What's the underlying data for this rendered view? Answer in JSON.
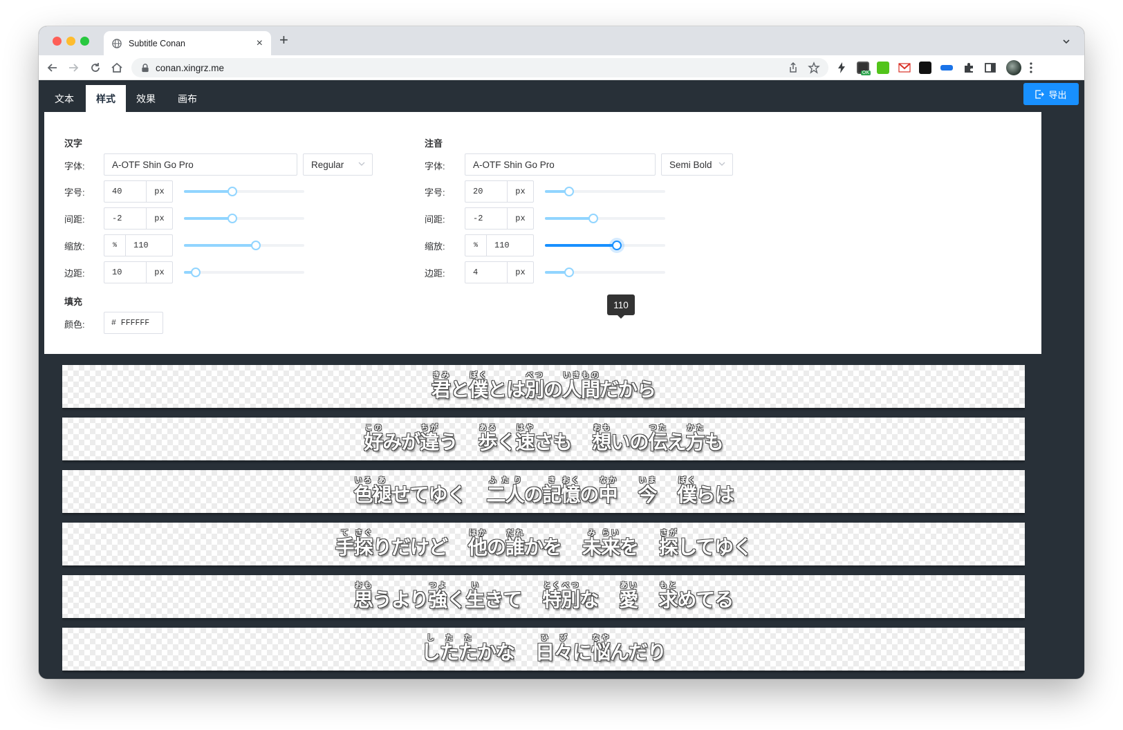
{
  "browser": {
    "tab_title": "Subtitle Conan",
    "url": "conan.xingrz.me"
  },
  "app": {
    "tabs": [
      "文本",
      "样式",
      "效果",
      "画布"
    ],
    "active_tab": "样式",
    "export_label": "导出"
  },
  "kanji": {
    "title": "汉字",
    "font_label": "字体:",
    "font": "A-OTF Shin Go Pro",
    "weight": "Regular",
    "size_label": "字号:",
    "size": "40",
    "size_unit": "px",
    "size_level": 0.4,
    "spacing_label": "间距:",
    "spacing": "-2",
    "spacing_unit": "px",
    "spacing_level": 0.4,
    "scale_label": "缩放:",
    "scale_prefix": "%",
    "scale": "110",
    "scale_level": 0.6,
    "margin_label": "边距:",
    "margin": "10",
    "margin_unit": "px",
    "margin_level": 0.1
  },
  "fill": {
    "title": "填充",
    "color_label": "颜色:",
    "color": "# FFFFFF"
  },
  "ruby": {
    "title": "注音",
    "font_label": "字体:",
    "font": "A-OTF Shin Go Pro",
    "weight": "Semi Bold",
    "size_label": "字号:",
    "size": "20",
    "size_unit": "px",
    "size_level": 0.2,
    "spacing_label": "间距:",
    "spacing": "-2",
    "spacing_unit": "px",
    "spacing_level": 0.4,
    "scale_label": "缩放:",
    "scale_prefix": "%",
    "scale": "110",
    "scale_level": 0.6,
    "margin_label": "边距:",
    "margin": "4",
    "margin_unit": "px",
    "margin_level": 0.2
  },
  "tooltip": "110",
  "subtitles": [
    [
      [
        "君",
        "きみ"
      ],
      [
        "と",
        ""
      ],
      [
        "僕",
        "ぼく"
      ],
      [
        "とは",
        ""
      ],
      [
        "別",
        "べつ"
      ],
      [
        "の",
        ""
      ],
      [
        "人間",
        "いきもの"
      ],
      [
        "だから",
        ""
      ]
    ],
    [
      [
        "好",
        "この"
      ],
      [
        "みが",
        ""
      ],
      [
        "違",
        "ちが"
      ],
      [
        "う",
        ""
      ],
      [
        " ",
        ""
      ],
      [
        "歩",
        "ある"
      ],
      [
        "く",
        ""
      ],
      [
        "速",
        "はや"
      ],
      [
        "さも",
        ""
      ],
      [
        " ",
        ""
      ],
      [
        "想",
        "おも"
      ],
      [
        "いの",
        ""
      ],
      [
        "伝",
        "つた"
      ],
      [
        "え",
        ""
      ],
      [
        "方",
        "かた"
      ],
      [
        "も",
        ""
      ]
    ],
    [
      [
        "色",
        "いろ"
      ],
      [
        "褪",
        "あ"
      ],
      [
        "せてゆく",
        ""
      ],
      [
        " ",
        ""
      ],
      [
        "二人",
        "ふたり"
      ],
      [
        "の",
        ""
      ],
      [
        "記",
        "き"
      ],
      [
        "憶",
        "おく"
      ],
      [
        "の",
        ""
      ],
      [
        "中",
        "なか"
      ],
      [
        " ",
        ""
      ],
      [
        "今",
        "いま"
      ],
      [
        " ",
        ""
      ],
      [
        "僕",
        "ぼく"
      ],
      [
        "らは",
        ""
      ]
    ],
    [
      [
        "手",
        "て"
      ],
      [
        "探",
        "さぐ"
      ],
      [
        "りだけど",
        ""
      ],
      [
        " ",
        ""
      ],
      [
        "他",
        "ほか"
      ],
      [
        "の",
        ""
      ],
      [
        "誰",
        "だれ"
      ],
      [
        "かを",
        ""
      ],
      [
        " ",
        ""
      ],
      [
        "未",
        "み"
      ],
      [
        "来",
        "らい"
      ],
      [
        "を",
        ""
      ],
      [
        " ",
        ""
      ],
      [
        "探",
        "さが"
      ],
      [
        "してゆく",
        ""
      ]
    ],
    [
      [
        "思",
        "おも"
      ],
      [
        "うより",
        ""
      ],
      [
        "強",
        "つよ"
      ],
      [
        "く",
        ""
      ],
      [
        "生",
        "い"
      ],
      [
        "きて",
        ""
      ],
      [
        " ",
        ""
      ],
      [
        "特別",
        "とくべつ"
      ],
      [
        "な",
        ""
      ],
      [
        " ",
        ""
      ],
      [
        "愛",
        "あい"
      ],
      [
        " ",
        ""
      ],
      [
        "求",
        "もと"
      ],
      [
        "めてる",
        ""
      ]
    ],
    [
      [
        "したた",
        "したた"
      ],
      [
        "かな",
        ""
      ],
      [
        " ",
        ""
      ],
      [
        "日",
        "ひ"
      ],
      [
        "々",
        "び"
      ],
      [
        "に",
        ""
      ],
      [
        "悩",
        "なや"
      ],
      [
        "んだり",
        ""
      ]
    ]
  ]
}
